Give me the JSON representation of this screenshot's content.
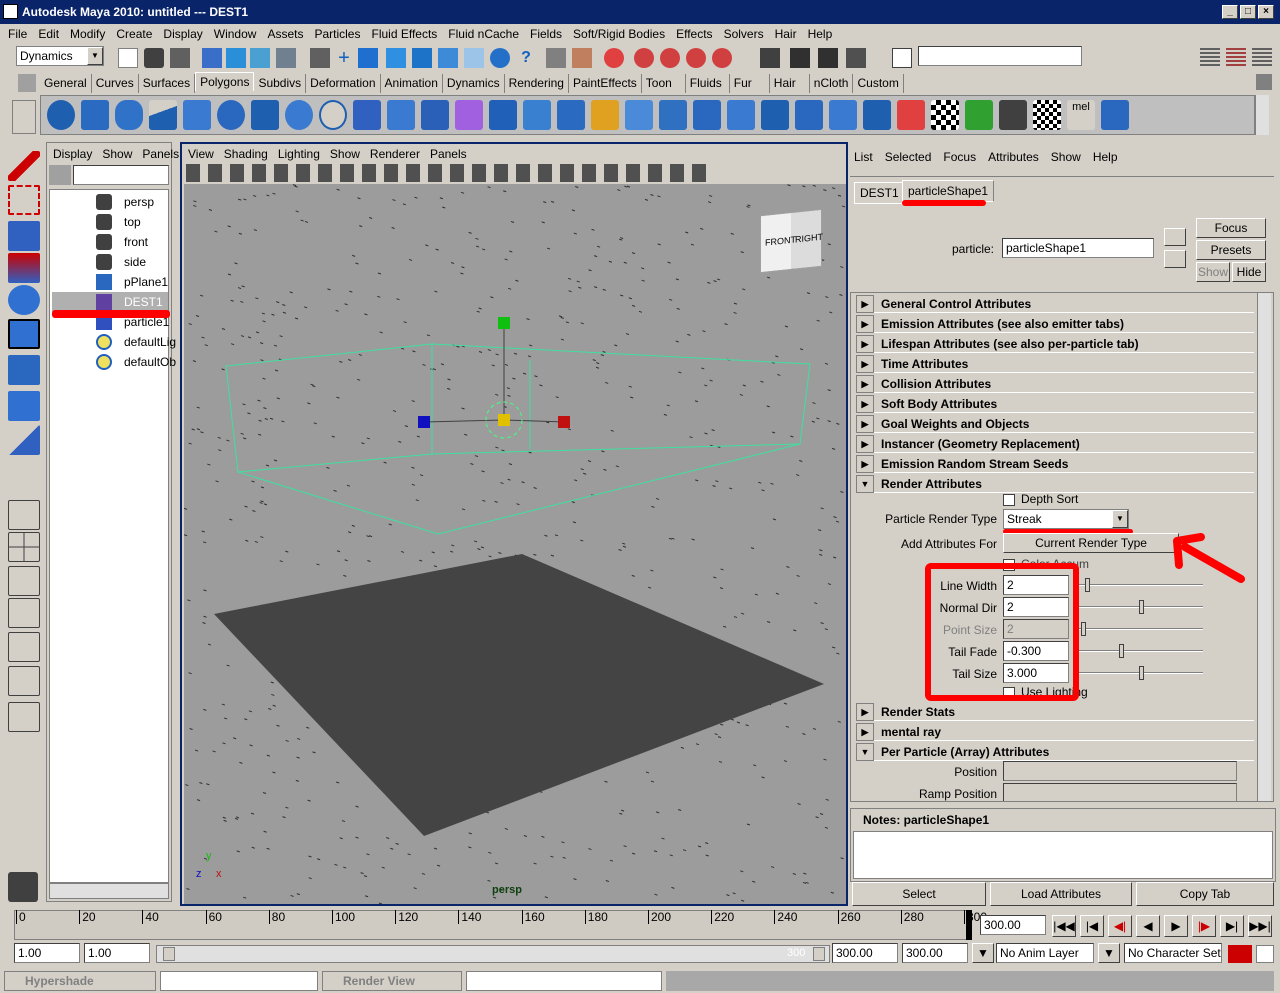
{
  "window": {
    "title": "Autodesk Maya 2010: untitled   ---   DEST1"
  },
  "menubar": [
    "File",
    "Edit",
    "Modify",
    "Create",
    "Display",
    "Window",
    "Assets",
    "Particles",
    "Fluid Effects",
    "Fluid nCache",
    "Fields",
    "Soft/Rigid Bodies",
    "Effects",
    "Solvers",
    "Hair",
    "Help"
  ],
  "statusline": {
    "menu_set": "Dynamics",
    "input_value": ""
  },
  "shelf_tabs": [
    "General",
    "Curves",
    "Surfaces",
    "Polygons",
    "Subdivs",
    "Deformation",
    "Animation",
    "Dynamics",
    "Rendering",
    "PaintEffects",
    "Toon",
    "Fluids",
    "Fur",
    "Hair",
    "nCloth",
    "Custom"
  ],
  "shelf_active": "Polygons",
  "outliner": {
    "menu": [
      "Display",
      "Show",
      "Panels"
    ],
    "items": [
      {
        "label": "persp"
      },
      {
        "label": "top"
      },
      {
        "label": "front"
      },
      {
        "label": "side"
      },
      {
        "label": "pPlane1"
      },
      {
        "label": "DEST1"
      },
      {
        "label": "particle1"
      },
      {
        "label": "defaultLig"
      },
      {
        "label": "defaultOb"
      }
    ]
  },
  "viewport": {
    "menu": [
      "View",
      "Shading",
      "Lighting",
      "Show",
      "Renderer",
      "Panels"
    ],
    "camera_label": "persp",
    "cube_front": "FRONT",
    "cube_right": "RIGHT",
    "axis_y": "y",
    "axis_z": "z",
    "axis_x": "x"
  },
  "attribute_editor": {
    "menu": [
      "List",
      "Selected",
      "Focus",
      "Attributes",
      "Show",
      "Help"
    ],
    "tabs": [
      "DEST1",
      "particleShape1"
    ],
    "node_type_label": "particle:",
    "node_name": "particleShape1",
    "focus_btn": "Focus",
    "presets_btn": "Presets",
    "show_btn": "Show",
    "hide_btn": "Hide",
    "sections_collapsed": [
      "General Control Attributes",
      "Emission Attributes (see also emitter tabs)",
      "Lifespan Attributes (see also per-particle tab)",
      "Time Attributes",
      "Collision Attributes",
      "Soft Body Attributes",
      "Goal Weights and Objects",
      "Instancer (Geometry Replacement)",
      "Emission Random Stream Seeds"
    ],
    "render_section": "Render Attributes",
    "depth_sort": "Depth Sort",
    "particle_render_type_label": "Particle Render Type",
    "particle_render_type": "Streak",
    "add_attrs_label": "Add Attributes For",
    "add_attrs_btn": "Current Render Type",
    "color_accum": "Color Accum",
    "line_width_label": "Line Width",
    "line_width": "2",
    "normal_dir_label": "Normal Dir",
    "normal_dir": "2",
    "point_size_label": "Point Size",
    "point_size": "2",
    "tail_fade_label": "Tail Fade",
    "tail_fade": "-0.300",
    "tail_size_label": "Tail Size",
    "tail_size": "3.000",
    "use_lighting": "Use Lighting",
    "sections_after": [
      "Render Stats",
      "mental ray"
    ],
    "per_particle_section": "Per Particle (Array) Attributes",
    "position_label": "Position",
    "ramp_position_label": "Ramp Position",
    "notes_label": "Notes:  particleShape1",
    "select_btn": "Select",
    "load_btn": "Load Attributes",
    "copy_btn": "Copy Tab"
  },
  "timeline": {
    "ticks": [
      "0",
      "20",
      "40",
      "60",
      "80",
      "100",
      "120",
      "140",
      "160",
      "180",
      "200",
      "220",
      "240",
      "260",
      "280",
      "300"
    ],
    "current_frame": "300.00"
  },
  "range": {
    "start": "1.00",
    "start2": "1.00",
    "slider_end_label": "300",
    "end": "300.00",
    "end2": "300.00",
    "anim_layer": "No Anim Layer",
    "char_set": "No Character Set"
  },
  "taskbar": [
    "Hypershade",
    "Render View"
  ]
}
